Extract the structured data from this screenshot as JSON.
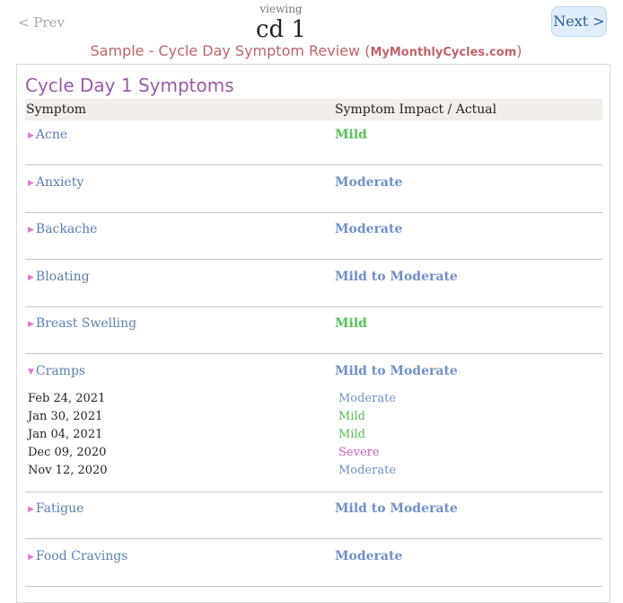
{
  "nav": {
    "prev_label": "< Prev",
    "next_label": "Next >",
    "viewing_label": "viewing",
    "cycle_day": "cd 1"
  },
  "subtitle": {
    "text": "Sample - Cycle Day Symptom Review (",
    "site": "MyMonthlyCycles.com",
    "close": ")"
  },
  "panel": {
    "title": "Cycle Day 1 Symptoms",
    "col_symptom": "Symptom",
    "col_impact": "Symptom Impact / Actual"
  },
  "colors": {
    "mild": "#55c255",
    "moderate": "#6f8fc9",
    "severe": "#c65bc0",
    "link": "#5a7fb6",
    "title": "#9a5aa8",
    "subtitle": "#c0646a"
  },
  "symptoms": [
    {
      "name": "Acne",
      "impact": "Mild",
      "level": "mild",
      "expanded": false
    },
    {
      "name": "Anxiety",
      "impact": "Moderate",
      "level": "moderate",
      "expanded": false
    },
    {
      "name": "Backache",
      "impact": "Moderate",
      "level": "moderate",
      "expanded": false
    },
    {
      "name": "Bloating",
      "impact": "Mild to Moderate",
      "level": "moderate",
      "expanded": false
    },
    {
      "name": "Breast Swelling",
      "impact": "Mild",
      "level": "mild",
      "expanded": false
    },
    {
      "name": "Cramps",
      "impact": "Mild to Moderate",
      "level": "moderate",
      "expanded": true,
      "history": [
        {
          "date": "Feb 24, 2021",
          "value": "Moderate",
          "level": "moderate"
        },
        {
          "date": "Jan 30, 2021",
          "value": "Mild",
          "level": "mild"
        },
        {
          "date": "Jan 04, 2021",
          "value": "Mild",
          "level": "mild"
        },
        {
          "date": "Dec 09, 2020",
          "value": "Severe",
          "level": "severe"
        },
        {
          "date": "Nov 12, 2020",
          "value": "Moderate",
          "level": "moderate"
        }
      ]
    },
    {
      "name": "Fatigue",
      "impact": "Mild to Moderate",
      "level": "moderate",
      "expanded": false
    },
    {
      "name": "Food Cravings",
      "impact": "Moderate",
      "level": "moderate",
      "expanded": false
    }
  ]
}
